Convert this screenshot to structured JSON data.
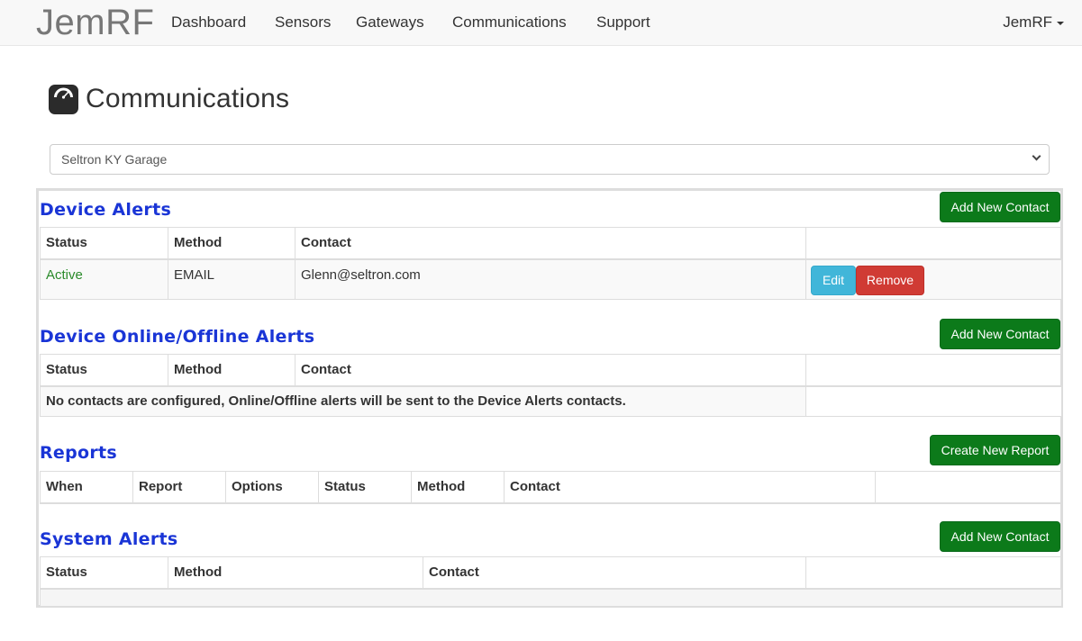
{
  "navbar": {
    "brand": "JemRF",
    "items": [
      "Dashboard",
      "Sensors",
      "Gateways",
      "Communications",
      "Support"
    ],
    "user": "JemRF"
  },
  "page": {
    "title": "Communications",
    "icon": "dashboard-gauge-icon"
  },
  "site_select": {
    "selected": "Seltron KY Garage"
  },
  "device_alerts": {
    "title": "Device Alerts",
    "add_button": "Add New Contact",
    "columns": [
      "Status",
      "Method",
      "Contact"
    ],
    "rows": [
      {
        "status": "Active",
        "method": "EMAIL",
        "contact": "Glenn@seltron.com",
        "edit": "Edit",
        "remove": "Remove"
      }
    ]
  },
  "online_alerts": {
    "title": "Device Online/Offline Alerts",
    "add_button": "Add New Contact",
    "columns": [
      "Status",
      "Method",
      "Contact"
    ],
    "empty_message": "No contacts are configured, Online/Offline alerts will be sent to the Device Alerts contacts."
  },
  "reports": {
    "title": "Reports",
    "add_button": "Create New Report",
    "columns": [
      "When",
      "Report",
      "Options",
      "Status",
      "Method",
      "Contact"
    ]
  },
  "system_alerts": {
    "title": "System Alerts",
    "add_button": "Add New Contact",
    "columns": [
      "Status",
      "Method",
      "Contact"
    ]
  },
  "colors": {
    "section_title": "#1a35d6",
    "success": "#0c7a1a",
    "info": "#41b6d9",
    "danger": "#d03b34",
    "active_status": "#2a8a2a"
  }
}
